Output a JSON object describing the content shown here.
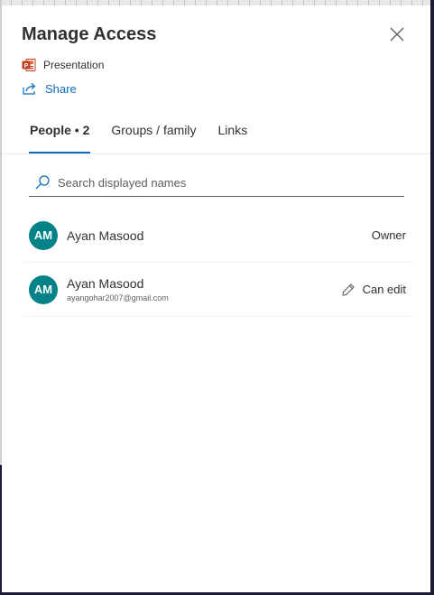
{
  "dialog": {
    "title": "Manage Access",
    "close_icon": "close-icon"
  },
  "file": {
    "icon": "powerpoint-icon",
    "name": "Presentation"
  },
  "share": {
    "icon": "share-icon",
    "label": "Share"
  },
  "tabs": [
    {
      "label": "People • 2",
      "active": true
    },
    {
      "label": "Groups / family",
      "active": false
    },
    {
      "label": "Links",
      "active": false
    }
  ],
  "search": {
    "icon": "search-icon",
    "placeholder": "Search displayed names",
    "value": ""
  },
  "people": [
    {
      "initials": "AM",
      "name": "Ayan Masood",
      "email": "",
      "permission": "Owner",
      "permission_icon": ""
    },
    {
      "initials": "AM",
      "name": "Ayan Masood",
      "email": "ayangohar2007@gmail.com",
      "permission": "Can edit",
      "permission_icon": "pencil-icon"
    }
  ],
  "colors": {
    "accent": "#0f6cbd",
    "avatar": "#038387",
    "powerpoint": "#c43e1c"
  }
}
